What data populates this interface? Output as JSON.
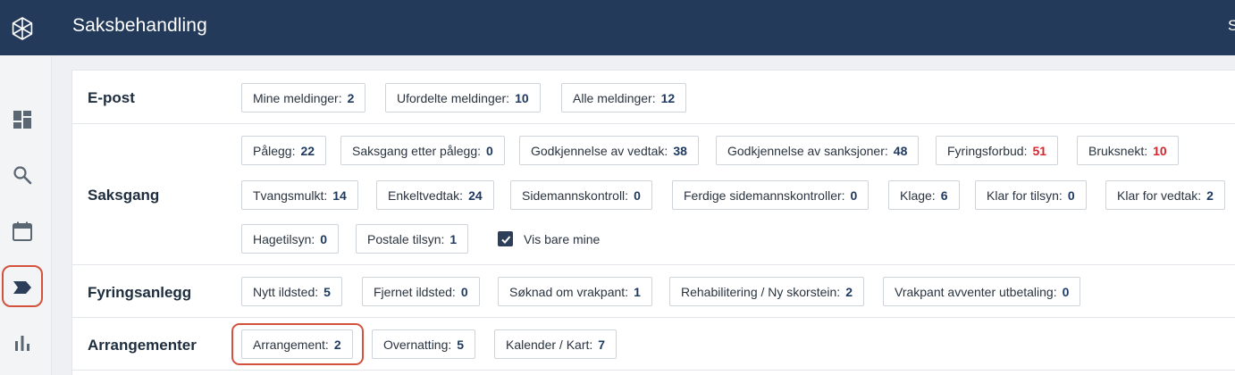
{
  "header": {
    "title": "Saksbehandling",
    "cut_text": "S"
  },
  "sidebar": {
    "items": [
      {
        "name": "dashboard",
        "icon": "dashboard-icon"
      },
      {
        "name": "search",
        "icon": "search-icon"
      },
      {
        "name": "calendar",
        "icon": "calendar-icon"
      },
      {
        "name": "casework",
        "icon": "tag-arrow-icon",
        "active": true
      },
      {
        "name": "statistics",
        "icon": "bar-chart-icon"
      }
    ]
  },
  "sections": {
    "epost": {
      "label": "E-post",
      "chips": [
        {
          "label": "Mine meldinger:",
          "count": "2"
        },
        {
          "label": "Ufordelte meldinger:",
          "count": "10"
        },
        {
          "label": "Alle meldinger:",
          "count": "12"
        }
      ]
    },
    "saksgang": {
      "label": "Saksgang",
      "chips": [
        {
          "label": "Pålegg:",
          "count": "22"
        },
        {
          "label": "Saksgang etter pålegg:",
          "count": "0"
        },
        {
          "label": "Godkjennelse av vedtak:",
          "count": "38"
        },
        {
          "label": "Godkjennelse av sanksjoner:",
          "count": "48"
        },
        {
          "label": "Fyringsforbud:",
          "count": "51",
          "alert": true
        },
        {
          "label": "Bruksnekt:",
          "count": "10",
          "alert": true
        },
        {
          "label": "Tvangsmulkt:",
          "count": "14"
        },
        {
          "label": "Enkeltvedtak:",
          "count": "24"
        },
        {
          "label": "Sidemannskontroll:",
          "count": "0"
        },
        {
          "label": "Ferdige sidemannskontroller:",
          "count": "0"
        },
        {
          "label": "Klage:",
          "count": "6"
        },
        {
          "label": "Klar for tilsyn:",
          "count": "0"
        },
        {
          "label": "Klar for vedtak:",
          "count": "2"
        },
        {
          "label": "Hagetilsyn:",
          "count": "0"
        },
        {
          "label": "Postale tilsyn:",
          "count": "1"
        }
      ],
      "checkbox": {
        "label": "Vis bare mine",
        "checked": true
      }
    },
    "fyringsanlegg": {
      "label": "Fyringsanlegg",
      "chips": [
        {
          "label": "Nytt ildsted:",
          "count": "5"
        },
        {
          "label": "Fjernet ildsted:",
          "count": "0"
        },
        {
          "label": "Søknad om vrakpant:",
          "count": "1"
        },
        {
          "label": "Rehabilitering / Ny skorstein:",
          "count": "2"
        },
        {
          "label": "Vrakpant avventer utbetaling:",
          "count": "0"
        }
      ]
    },
    "arrangementer": {
      "label": "Arrangementer",
      "chips": [
        {
          "label": "Arrangement:",
          "count": "2",
          "highlighted": true
        },
        {
          "label": "Overnatting:",
          "count": "5"
        },
        {
          "label": "Kalender / Kart:",
          "count": "7"
        }
      ]
    }
  },
  "colors": {
    "header_bg": "#243a5a",
    "alert": "#d9242b",
    "count": "#1f3a60",
    "highlight": "#d4513e"
  }
}
